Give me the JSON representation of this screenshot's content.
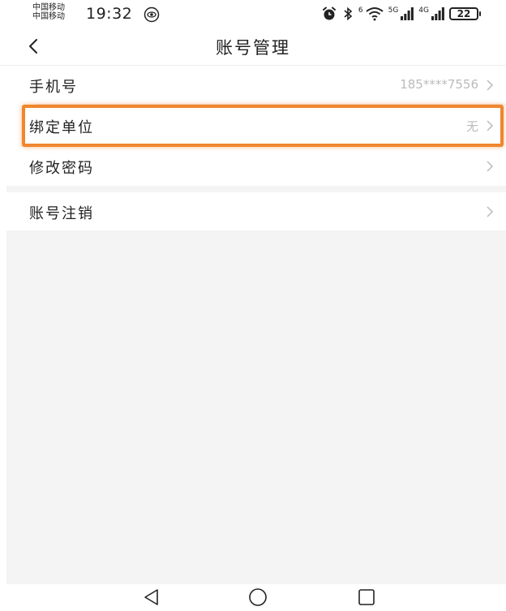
{
  "status_bar": {
    "carrier_1": "中国移动",
    "carrier_2": "中国移动",
    "time": "19:32",
    "wifi_badge": "6",
    "signal_5g": "5G",
    "signal_4g": "4G",
    "battery": "22"
  },
  "header": {
    "back_icon": "chevron-left-icon",
    "title": "账号管理"
  },
  "rows": [
    {
      "label": "手机号",
      "value": "185****7556",
      "icon": "chevron-right-icon"
    },
    {
      "label": "绑定单位",
      "value": "无",
      "icon": "chevron-right-icon",
      "highlighted": true
    },
    {
      "label": "修改密码",
      "value": "",
      "icon": "chevron-right-icon"
    },
    {
      "label": "账号注销",
      "value": "",
      "icon": "chevron-right-icon"
    }
  ],
  "bottom_nav": {
    "back": "triangle-back-icon",
    "home": "circle-home-icon",
    "recents": "square-recents-icon"
  },
  "colors": {
    "highlight": "#f0862e",
    "background": "#f4f4f4",
    "secondary_text": "#bbbbbb"
  }
}
